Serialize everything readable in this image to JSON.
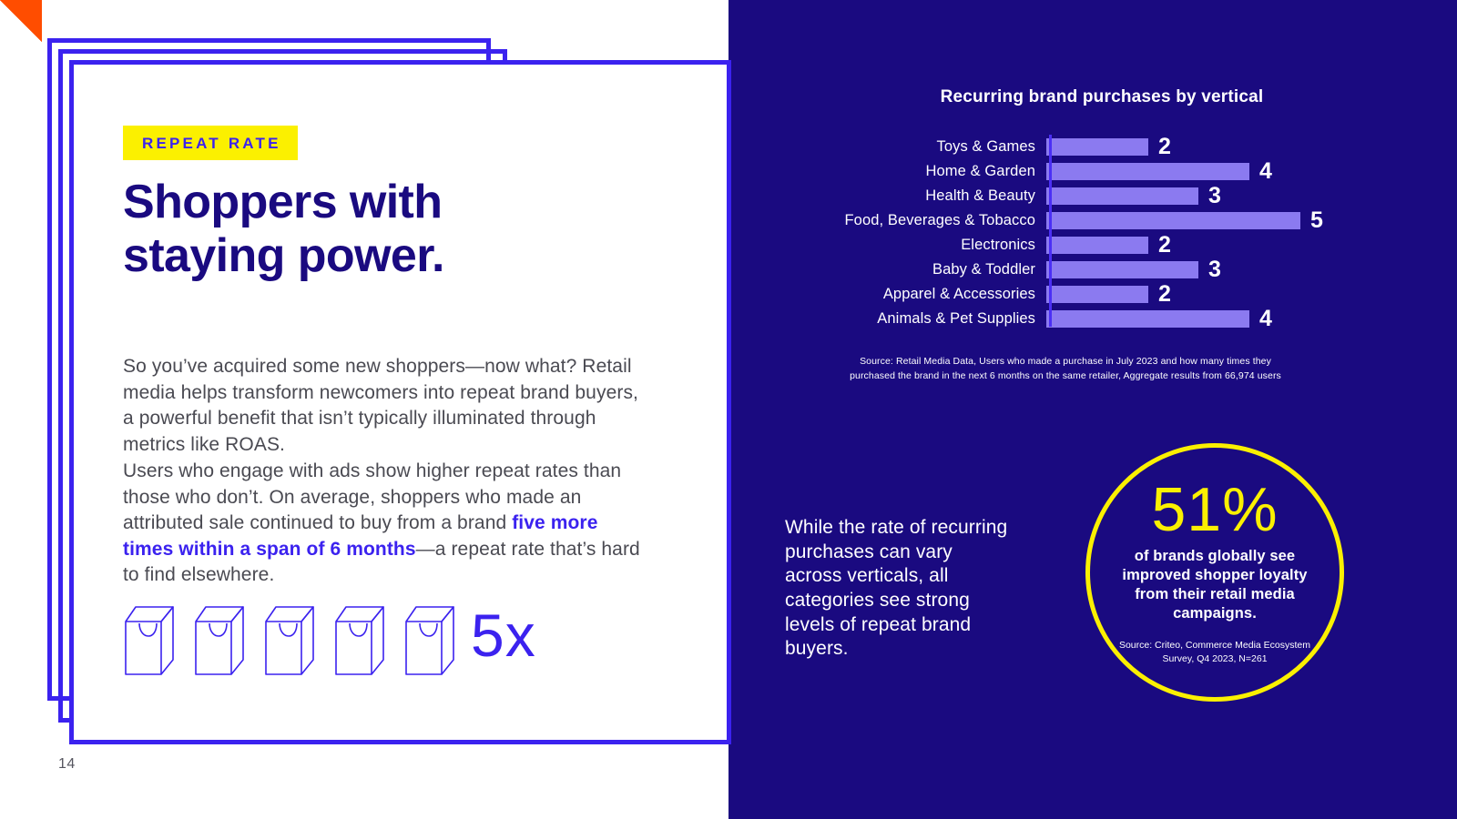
{
  "colors": {
    "navy": "#1a0a80",
    "blue_violet": "#3b22ef",
    "yellow": "#fbf000",
    "orange": "#ff4d00",
    "bar_purple": "#8b7af0",
    "body_gray": "#4a4a52",
    "white": "#ffffff"
  },
  "left": {
    "eyebrow": "REPEAT RATE",
    "headline_line1": "Shoppers with",
    "headline_line2": "staying power.",
    "paragraph1": "So you’ve acquired some new shoppers—now what? Retail media helps transform newcomers into repeat brand buyers, a powerful benefit that isn’t typically illuminated through metrics like ROAS.",
    "paragraph2_pre": "Users who engage with ads show higher repeat rates than those who don’t. On average, shoppers who made an attributed sale continued to buy from a brand ",
    "paragraph2_highlight": "five more times within a span of 6 months",
    "paragraph2_post": "—a repeat rate that’s hard to find elsewhere.",
    "multiplier": "5x",
    "bag_count": 5,
    "bag_icon_name": "shopping-bag-icon",
    "page_number": "14"
  },
  "chart_data": {
    "type": "bar",
    "orientation": "horizontal",
    "title": "Recurring brand purchases by vertical",
    "categories": [
      "Toys & Games",
      "Home & Garden",
      "Health & Beauty",
      "Food, Beverages & Tobacco",
      "Electronics",
      "Baby & Toddler",
      "Apparel & Accessories",
      "Animals & Pet Supplies"
    ],
    "values": [
      2,
      4,
      3,
      5,
      2,
      3,
      2,
      4
    ],
    "value_labels": [
      "2",
      "4",
      "3",
      "5",
      "2",
      "3",
      "2",
      "4"
    ],
    "xlabel": "",
    "ylabel": "",
    "xlim": [
      0,
      5
    ],
    "grid": false,
    "legend": false,
    "bar_color": "#8b7af0",
    "background": "#1a0a80",
    "source": "Source: Retail Media Data, Users who made a purchase in July 2023 and how many times they purchased the brand in the next 6 months on the same retailer, Aggregate results from 66,974 users"
  },
  "right": {
    "paragraph": "While the rate of recurring purchases can vary across verticals, all categories see strong levels of repeat brand buyers."
  },
  "circle_stat": {
    "number": "51%",
    "caption": "of brands globally see improved shopper loyalty from their retail media campaigns.",
    "source": "Source: Criteo, Commerce Media Ecosystem Survey, Q4 2023, N=261"
  }
}
